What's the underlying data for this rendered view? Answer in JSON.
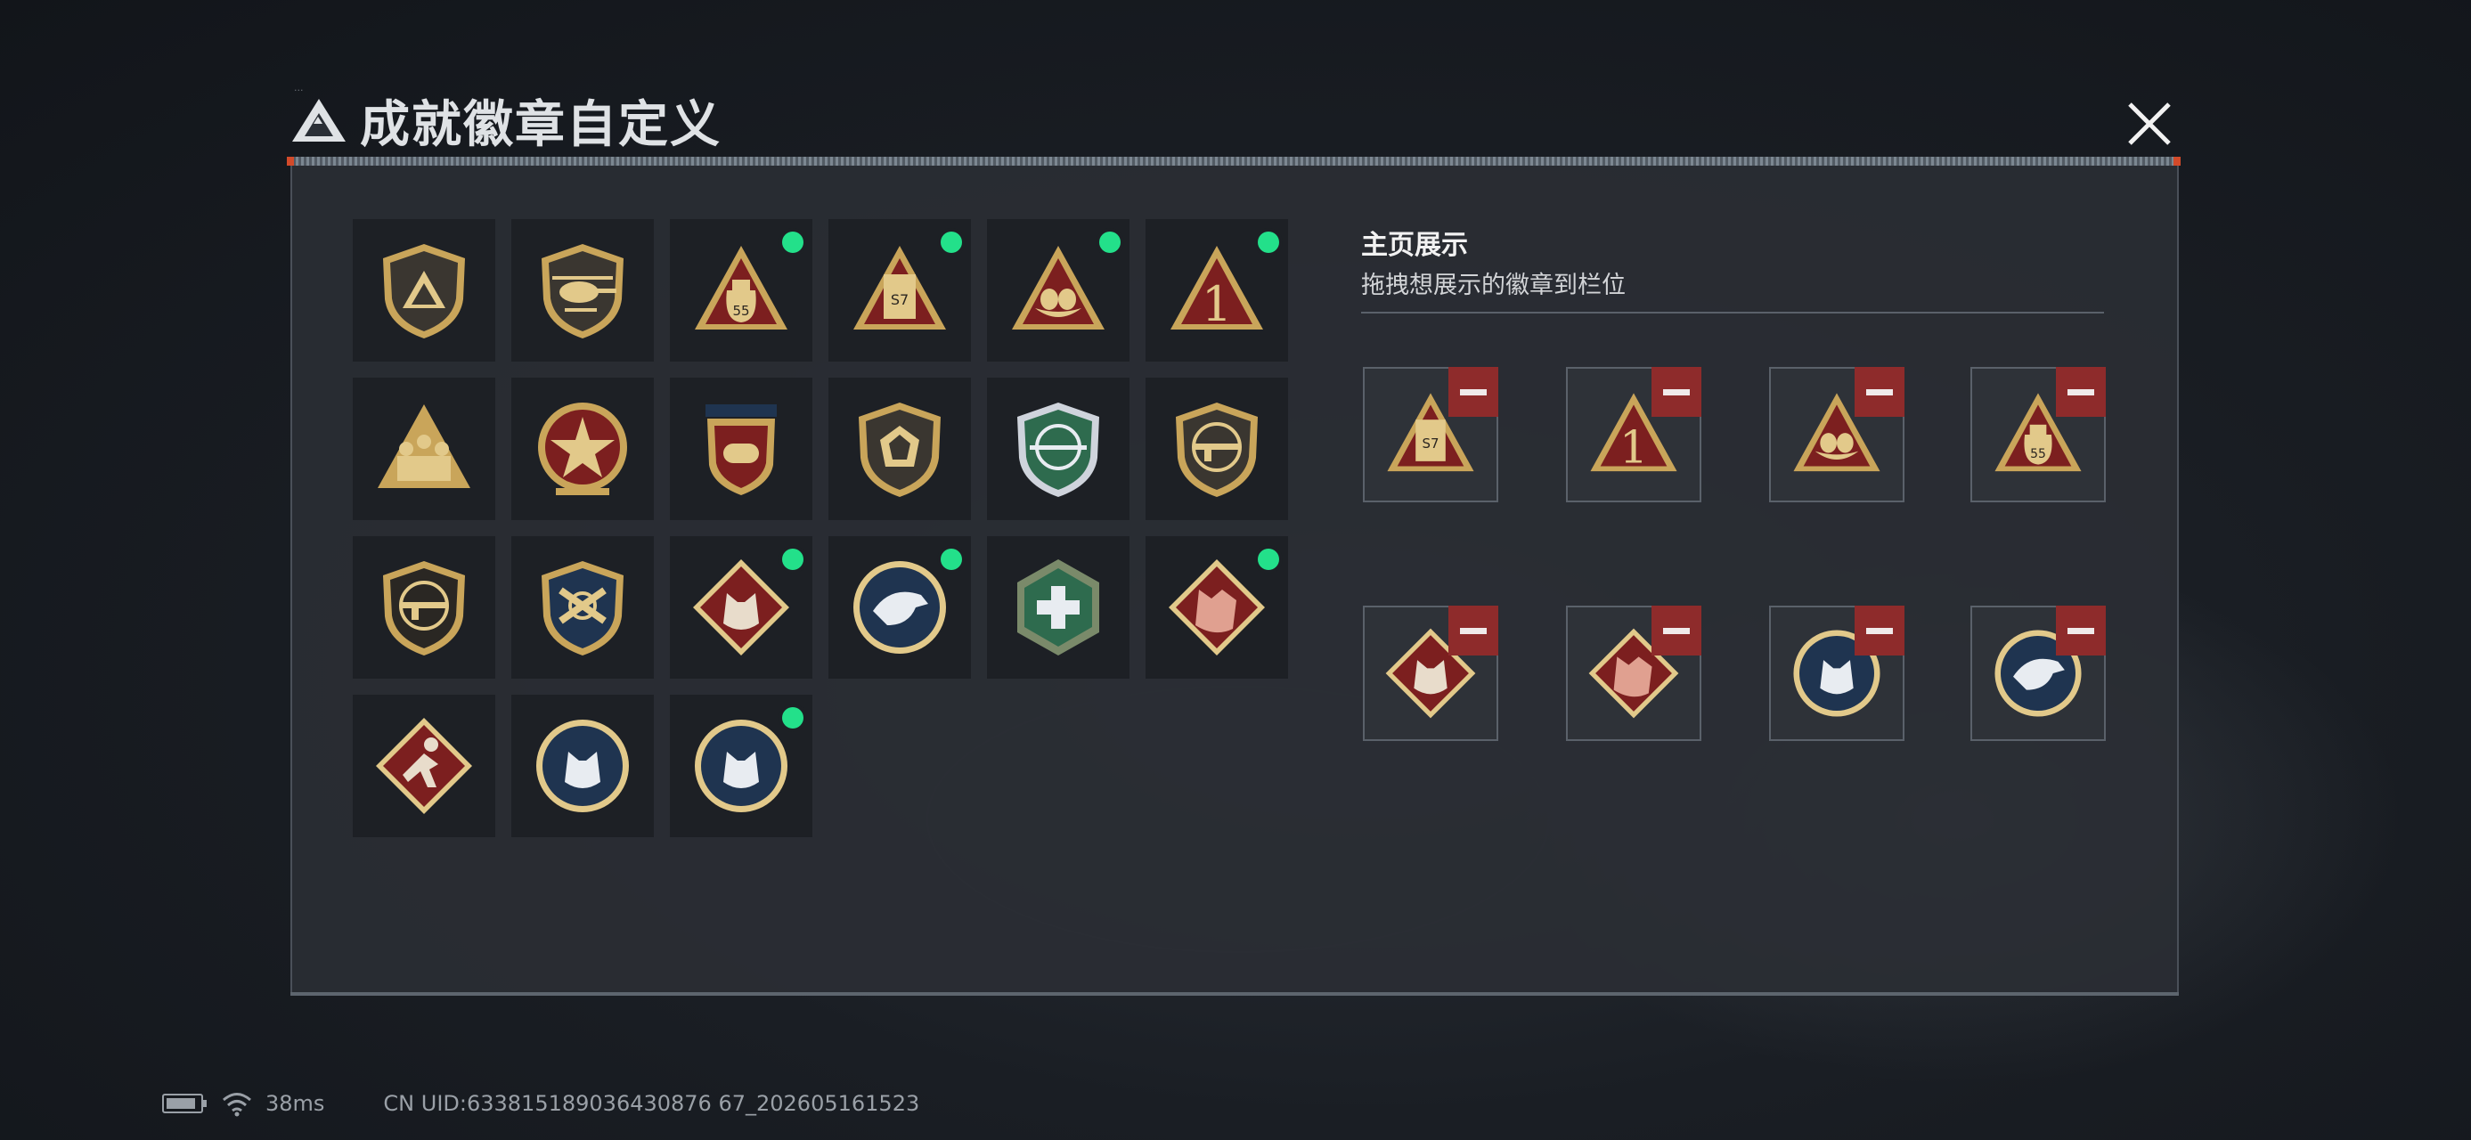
{
  "header": {
    "title": "成就徽章自定义",
    "tiny_text": "...",
    "close_icon": "close-icon"
  },
  "colors": {
    "accent_green": "#23e08a",
    "remove_red": "#8e2b2b",
    "gold": "#c9a55a",
    "crimson": "#7c1f1f",
    "navy": "#1f3450"
  },
  "badges": [
    {
      "icon": "triangle-logo-shield-badge",
      "new": false
    },
    {
      "icon": "helicopter-shield-badge",
      "new": false
    },
    {
      "icon": "money-bag-55-badge",
      "new": true
    },
    {
      "icon": "s7-card-badge",
      "new": true
    },
    {
      "icon": "nest-eggs-badge",
      "new": true
    },
    {
      "icon": "number-one-badge",
      "new": true
    },
    {
      "icon": "squad-soldiers-badge",
      "new": false
    },
    {
      "icon": "star-compass-badge",
      "new": false
    },
    {
      "icon": "stars-shield-badge",
      "new": false
    },
    {
      "icon": "gem-shield-badge",
      "new": false
    },
    {
      "icon": "sniper-crosshair-badge",
      "new": false
    },
    {
      "icon": "rifle-shield-badge",
      "new": false
    },
    {
      "icon": "rifle-shield-dark-badge",
      "new": false
    },
    {
      "icon": "crossed-guns-shield-badge",
      "new": false
    },
    {
      "icon": "wolf-diamond-badge",
      "new": true
    },
    {
      "icon": "eagle-round-badge",
      "new": true
    },
    {
      "icon": "medic-hexagon-badge",
      "new": false
    },
    {
      "icon": "dragon-diamond-badge",
      "new": true
    },
    {
      "icon": "runner-diamond-badge",
      "new": false
    },
    {
      "icon": "lynx-round-badge",
      "new": false
    },
    {
      "icon": "lynx-round-badge-2",
      "new": true
    }
  ],
  "showcase": {
    "title": "主页展示",
    "subtitle": "拖拽想展示的徽章到栏位",
    "slots": [
      {
        "icon": "s7-card-badge"
      },
      {
        "icon": "number-one-badge"
      },
      {
        "icon": "nest-eggs-badge"
      },
      {
        "icon": "money-bag-55-badge"
      },
      {
        "icon": "wolf-diamond-badge"
      },
      {
        "icon": "dragon-diamond-badge"
      },
      {
        "icon": "lynx-round-badge"
      },
      {
        "icon": "eagle-round-badge"
      }
    ]
  },
  "status_bar": {
    "ping": "38ms",
    "uid": "CN UID:633815189036430876 67_202605161523"
  }
}
